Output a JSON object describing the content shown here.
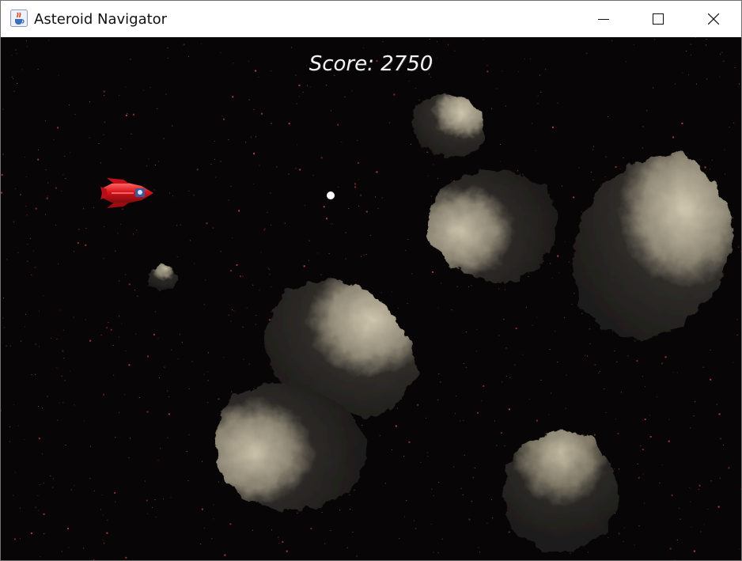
{
  "window": {
    "title": "Asteroid Navigator",
    "app_icon": "java-cup-icon",
    "controls": [
      "minimize-icon",
      "maximize-icon",
      "close-icon"
    ]
  },
  "hud": {
    "score_text": "Score: 2750"
  },
  "colors": {
    "space_background": "#070505",
    "star": "#c8473c",
    "ship_body": "#d8131b",
    "asteroid_shadow": "#262422",
    "asteroid_light": "#b9b19c",
    "bullet": "#ffffff",
    "score_text": "#f4f4f4"
  },
  "game": {
    "ship": "red-rocket-ship",
    "projectile": "white-bullet",
    "asteroid_count": 7
  }
}
